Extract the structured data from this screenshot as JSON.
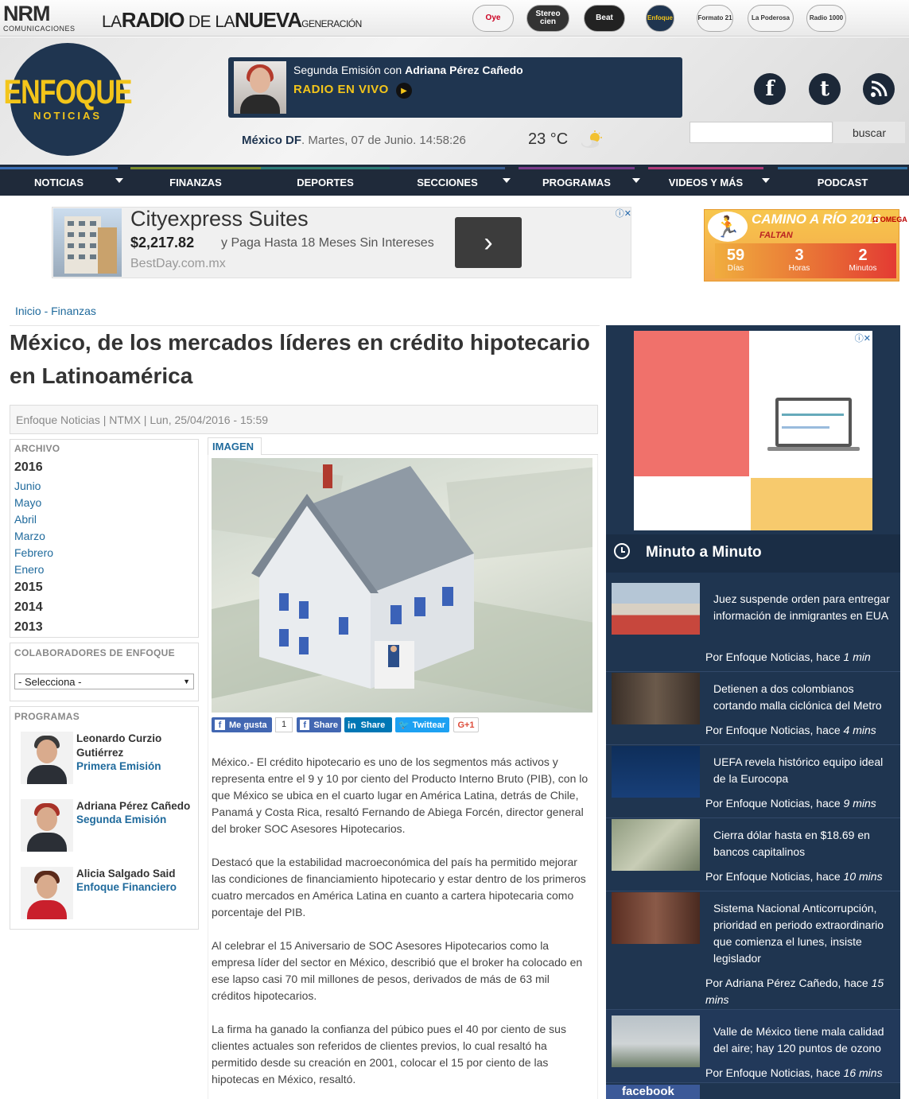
{
  "network": {
    "brand": "NRM",
    "brand_sub": "COMUNICACIONES",
    "slogan": [
      "LA",
      "RADIO",
      "DE LA",
      "NUEVA",
      "GENERACIÓN"
    ],
    "stations": [
      "Oye",
      "Stereo cien",
      "Beat",
      "Enfoque",
      "Formato 21",
      "La Poderosa",
      "Radio 1000"
    ]
  },
  "header": {
    "logo_top": "ENFOQUE",
    "logo_bottom": "NOTICIAS",
    "live_prefix": "Segunda Emisión con",
    "live_host": "Adriana Pérez Cañedo",
    "live_label": "RADIO EN VIVO",
    "city": "México DF",
    "datetime": ". Martes, 07 de Junio. 14:58:26",
    "temperature": "23 °C",
    "social": [
      "f",
      "t",
      "rss"
    ],
    "search_placeholder": "",
    "search_button": "buscar"
  },
  "nav": {
    "items": [
      {
        "label": "NOTICIAS",
        "dropdown": true,
        "color": "#3b6fb6"
      },
      {
        "label": "FINANZAS",
        "dropdown": false,
        "color": "#7a8c2e"
      },
      {
        "label": "DEPORTES",
        "dropdown": false,
        "color": "#2d7d78"
      },
      {
        "label": "SECCIONES",
        "dropdown": true,
        "color": "#3a5f92"
      },
      {
        "label": "PROGRAMAS",
        "dropdown": true,
        "color": "#7a3b8b"
      },
      {
        "label": "VIDEOS Y MÁS",
        "dropdown": true,
        "color": "#b03a7a"
      },
      {
        "label": "PODCAST",
        "dropdown": false,
        "color": "#2f6fa2"
      }
    ]
  },
  "ad": {
    "title": "Cityexpress Suites",
    "price": "$2,217.82",
    "subtitle": "y Paga Hasta 18 Meses Sin Intereses",
    "url": "BestDay.com.mx"
  },
  "rio": {
    "title": "CAMINO A RÍO 2016",
    "sponsor": "Ω OMEGA",
    "faltan": "FALTAN",
    "counters": [
      {
        "value": "59",
        "label": "Días"
      },
      {
        "value": "3",
        "label": "Horas"
      },
      {
        "value": "2",
        "label": "Minutos"
      }
    ]
  },
  "breadcrumb": "Inicio - Finanzas",
  "article": {
    "title": "México, de los mercados líderes en crédito hipotecario en Latinoamérica",
    "meta": "Enfoque Noticias | NTMX | Lun, 25/04/2016 - 15:59",
    "image_tab": "IMAGEN",
    "share": {
      "like": "Me gusta",
      "like_count": "1",
      "share": "Share",
      "in_share": "Share",
      "tweet": "Twittear",
      "gplus": "G+1"
    },
    "paragraphs": [
      "México.- El crédito hipotecario es uno de los segmentos más activos y representa entre el 9 y 10 por ciento del Producto Interno Bruto (PIB), con lo que México se ubica en el cuarto lugar en América Latina, detrás de Chile, Panamá y Costa Rica, resaltó Fernando de Abiega Forcén, director general del broker SOC Asesores Hipotecarios.",
      "Destacó que la estabilidad macroeconómica del país ha permitido mejorar las condiciones de financiamiento hipotecario y estar dentro de los primeros cuatro mercados en América Latina en cuanto a cartera hipotecaria como porcentaje del PIB.",
      "Al celebrar el 15 Aniversario de SOC Asesores Hipotecarios como la empresa líder del sector en México, describió que el broker ha colocado en ese lapso casi 70 mil millones de pesos, derivados de más de 63 mil créditos hipotecarios.",
      "La firma ha ganado la confianza del púbico pues el 40 por ciento de sus clientes actuales son referidos de clientes previos, lo cual resaltó ha permitido desde su creación en 2001, colocar el 15 por ciento de las hipotecas en México, resaltó."
    ]
  },
  "archive": {
    "title": "ARCHIVO",
    "year_2016": "2016",
    "months": [
      "Junio",
      "Mayo",
      "Abril",
      "Marzo",
      "Febrero",
      "Enero"
    ],
    "other_years": [
      "2015",
      "2014",
      "2013"
    ]
  },
  "collaborators": {
    "title": "COLABORADORES DE ENFOQUE",
    "select_value": "- Selecciona -"
  },
  "programs": {
    "title": "PROGRAMAS",
    "items": [
      {
        "name": "Leonardo Curzio Gutiérrez",
        "show": "Primera Emisión"
      },
      {
        "name": "Adriana Pérez Cañedo",
        "show": "Segunda Emisión"
      },
      {
        "name": "Alicia Salgado Said",
        "show": "Enfoque Financiero"
      }
    ]
  },
  "minuto": {
    "title": "Minuto a Minuto",
    "items": [
      {
        "title": "Juez suspende orden para entregar información de inmigrantes en EUA",
        "by": "Por Enfoque Noticias, hace ",
        "ago": "1 min"
      },
      {
        "title": "Detienen a dos colombianos cortando malla ciclónica del Metro",
        "by": "Por Enfoque Noticias, hace ",
        "ago": "4 mins"
      },
      {
        "title": "UEFA revela histórico equipo ideal de la Eurocopa",
        "by": "Por Enfoque Noticias, hace ",
        "ago": "9 mins"
      },
      {
        "title": "Cierra dólar hasta en $18.69 en bancos capitalinos",
        "by": "Por Enfoque Noticias, hace ",
        "ago": "10 mins"
      },
      {
        "title": "Sistema Nacional Anticorrupción, prioridad en periodo extraordinario que comienza el lunes, insiste legislador",
        "by": "Por Adriana Pérez Cañedo, hace ",
        "ago": "15 mins"
      },
      {
        "title": "Valle de México tiene mala calidad del aire; hay 120 puntos de ozono",
        "by": "Por Enfoque Noticias, hace ",
        "ago": "16 mins"
      }
    ],
    "facebook": "facebook"
  }
}
